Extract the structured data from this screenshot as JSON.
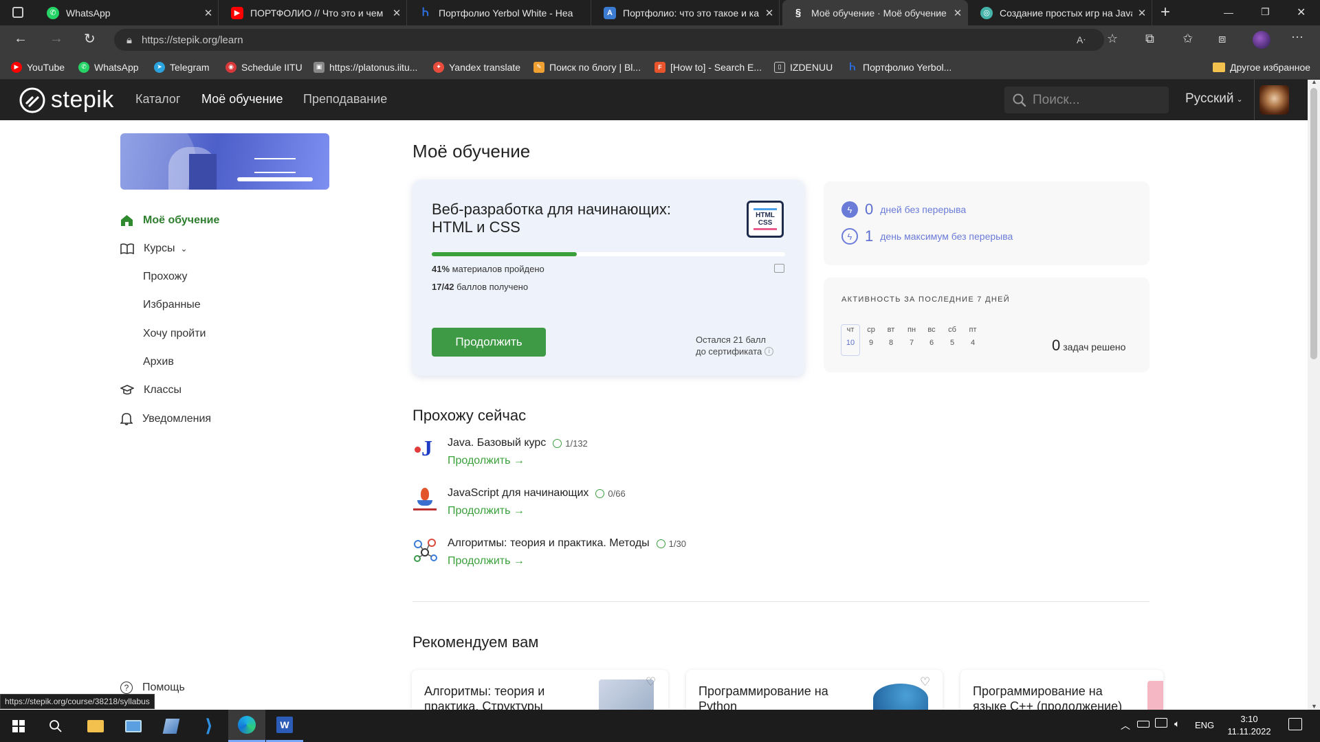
{
  "browser": {
    "tabs": [
      {
        "title": "WhatsApp",
        "icon": "whatsapp-icon",
        "color": "#25d366"
      },
      {
        "title": "ПОРТФОЛИО // Что это и чем",
        "icon": "youtube-icon",
        "color": "#ff0000"
      },
      {
        "title": "Портфолио Yerbol White - Hea",
        "icon": "headhunter-icon",
        "color": "#2b6cd8"
      },
      {
        "title": "Портфолио: что это такое и ка",
        "icon": "article-icon",
        "color": "#3b7bd1"
      },
      {
        "title": "Моё обучение · Моё обучение",
        "icon": "stepik-icon",
        "color": "#ffffff"
      },
      {
        "title": "Создание простых игр на Java",
        "icon": "globe-icon",
        "color": "#46b3a8"
      }
    ],
    "new_tab": "+",
    "url": "https://stepik.org/learn",
    "bookmarks": [
      {
        "label": "YouTube",
        "icon": "youtube-icon",
        "color": "#ff0000"
      },
      {
        "label": "WhatsApp",
        "icon": "whatsapp-icon",
        "color": "#25d366"
      },
      {
        "label": "Telegram",
        "icon": "telegram-icon",
        "color": "#2aa3df"
      },
      {
        "label": "Schedule IITU",
        "icon": "schedule-icon",
        "color": "#d9383a"
      },
      {
        "label": "https://platonus.iitu...",
        "icon": "page-icon",
        "color": "#888888"
      },
      {
        "label": "Yandex translate",
        "icon": "translate-icon",
        "color": "#e84c3d"
      },
      {
        "label": "Поиск по блогу | Bl...",
        "icon": "blog-icon",
        "color": "#f0a030"
      },
      {
        "label": "[How to] - Search E...",
        "icon": "howto-icon",
        "color": "#e8542c"
      },
      {
        "label": "IZDENUU",
        "icon": "doc-icon",
        "color": "#cccccc"
      },
      {
        "label": "Портфолио Yerbol...",
        "icon": "headhunter-icon",
        "color": "#2b6cd8"
      }
    ],
    "other_bookmarks": "Другое избранное",
    "status_url": "https://stepik.org/course/38218/syllabus"
  },
  "nav": {
    "logo": "stepik",
    "links": [
      "Каталог",
      "Моё обучение",
      "Преподавание"
    ],
    "search_placeholder": "Поиск...",
    "language": "Русский"
  },
  "sidebar": {
    "items": [
      {
        "label": "Моё обучение",
        "icon": "home-icon"
      },
      {
        "label": "Курсы",
        "icon": "book-icon"
      },
      {
        "label": "Классы",
        "icon": "graduation-cap-icon"
      },
      {
        "label": "Уведомления",
        "icon": "bell-icon"
      }
    ],
    "subitems": [
      "Прохожу",
      "Избранные",
      "Хочу пройти",
      "Архив"
    ],
    "help": "Помощь"
  },
  "main": {
    "page_title": "Моё обучение",
    "current_course": {
      "title_line1": "Веб-разработка для начинающих:",
      "title_line2": "HTML и CSS",
      "cover_label": "HTML CSS",
      "progress_percent": 41,
      "progress_value": "41%",
      "progress_text": "материалов пройдено",
      "score_value": "17/42",
      "score_text": "баллов получено",
      "continue_button": "Продолжить",
      "cert_line1": "Остался 21 балл",
      "cert_line2": "до сертификата"
    },
    "streak": {
      "days_value": "0",
      "days_label": "дней без перерыва",
      "max_value": "1",
      "max_label": "день максимум без перерыва"
    },
    "activity": {
      "title": "АКТИВНОСТЬ ЗА ПОСЛЕДНИЕ 7 ДНЕЙ",
      "days": [
        {
          "wd": "чт",
          "d": "10"
        },
        {
          "wd": "ср",
          "d": "9"
        },
        {
          "wd": "вт",
          "d": "8"
        },
        {
          "wd": "пн",
          "d": "7"
        },
        {
          "wd": "вс",
          "d": "6"
        },
        {
          "wd": "сб",
          "d": "5"
        },
        {
          "wd": "пт",
          "d": "4"
        }
      ],
      "tasks_value": "0",
      "tasks_label": "задач решено"
    },
    "in_progress_title": "Прохожу сейчас",
    "in_progress": [
      {
        "title": "Java. Базовый курс",
        "progress": "1/132",
        "continue": "Продолжить →"
      },
      {
        "title": "JavaScript для начинающих",
        "progress": "0/66",
        "continue": "Продолжить →"
      },
      {
        "title": "Алгоритмы: теория и практика. Методы",
        "progress": "1/30",
        "continue": "Продолжить →"
      }
    ],
    "recommended_title": "Рекомендуем вам",
    "recommended": [
      {
        "line1": "Алгоритмы: теория и",
        "line2": "практика. Структуры"
      },
      {
        "line1": "Программирование на",
        "line2": "Python"
      },
      {
        "line1": "Программирование на",
        "line2": "языке C++ (продолжение)"
      }
    ]
  },
  "taskbar": {
    "lang": "ENG",
    "time": "3:10",
    "date": "11.11.2022"
  }
}
